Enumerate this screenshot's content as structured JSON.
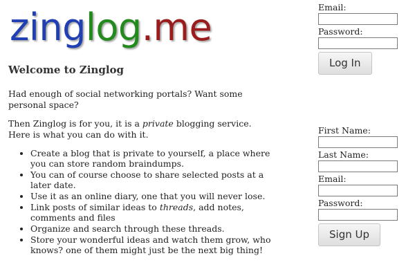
{
  "logo": {
    "parts": [
      "zing",
      "log",
      ".me"
    ],
    "colors": [
      "#1f3fb3",
      "#238a1e",
      "#9a1c1c"
    ]
  },
  "login": {
    "email_label": "Email:",
    "password_label": "Password:",
    "button_label": "Log In"
  },
  "signup": {
    "first_name_label": "First Name:",
    "last_name_label": "Last Name:",
    "email_label": "Email:",
    "password_label": "Password:",
    "button_label": "Sign Up"
  },
  "main": {
    "heading": "Welcome to Zinglog",
    "intro": "Had enough of social networking portals? Want some personal space?",
    "lead_before": "Then Zinglog is for you, it is a ",
    "lead_em": "private",
    "lead_after": " blogging service. Here is what you can do with it.",
    "features": [
      "Create a blog that is private to yourself, a place where you can store random braindumps.",
      "You can of course choose to share selected posts at a later date.",
      "Use it as an online diary, one that you will never lose.",
      {
        "before": "Link posts of similar ideas to ",
        "em": "threads",
        "after": ", add notes, comments and files"
      },
      "Organize and search through these threads.",
      "Store your wonderful ideas and watch them grow, who knows? one of them might just be the next big thing!"
    ]
  }
}
